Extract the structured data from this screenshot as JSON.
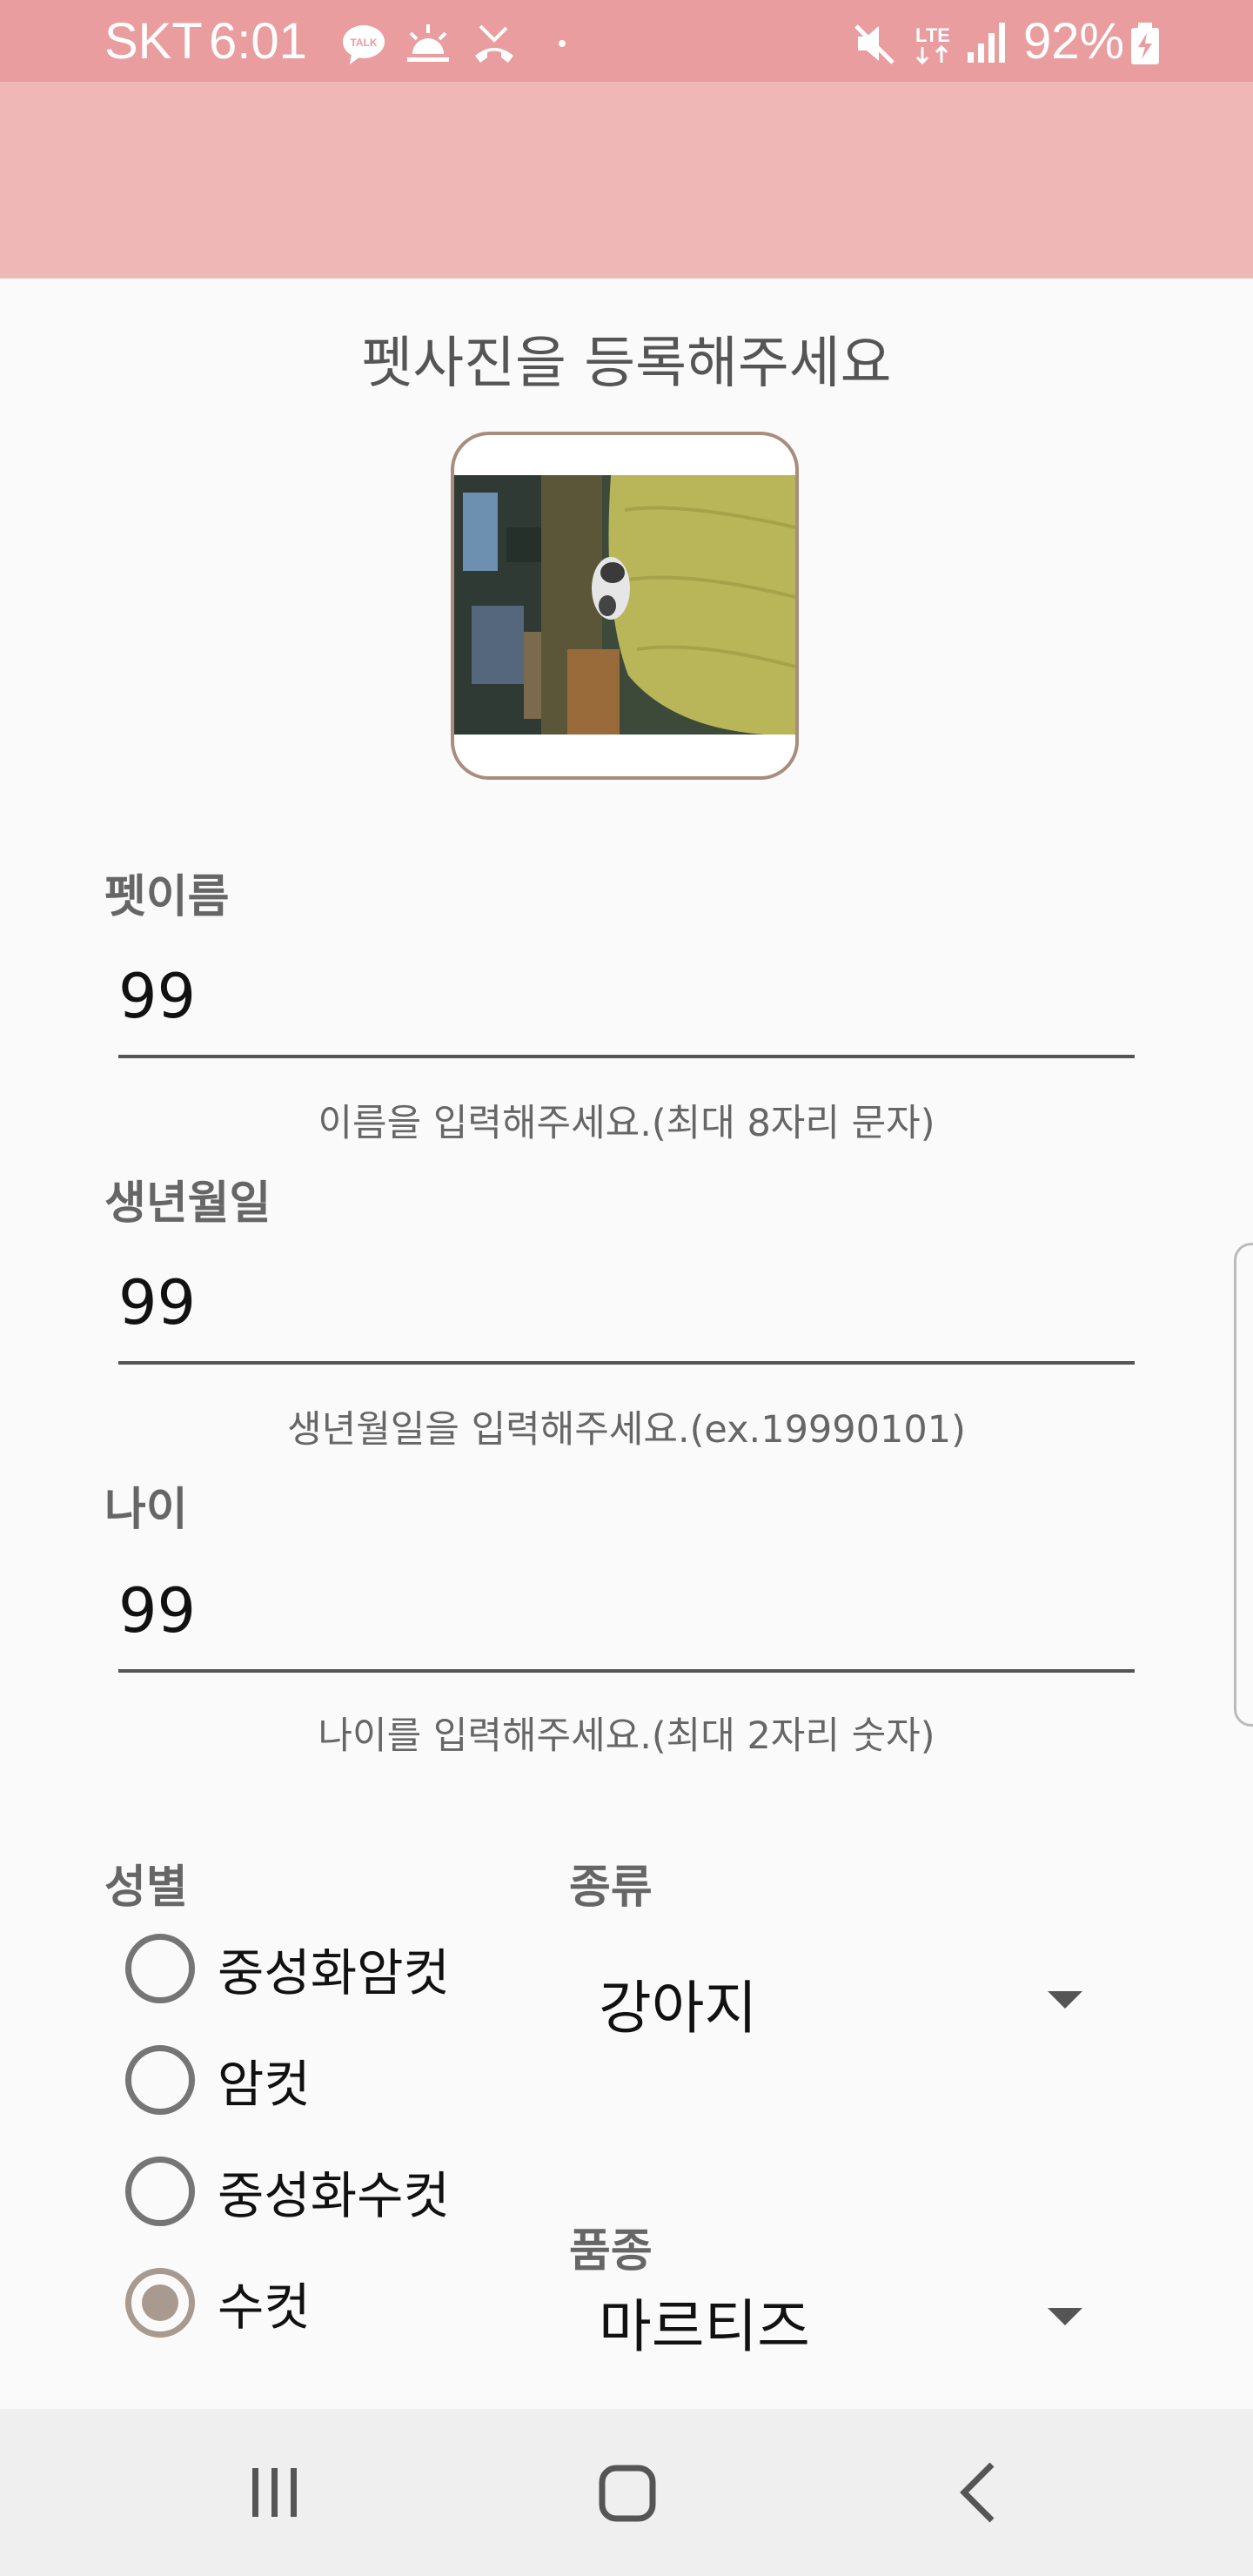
{
  "status_bar": {
    "carrier": "SKT",
    "time": "6:01",
    "battery": "92%",
    "icons": [
      "kakaotalk-icon",
      "weather-icon",
      "missed-call-icon",
      "dot-icon",
      "mute-icon",
      "lte-icon",
      "signal-icon",
      "battery-charging-icon"
    ],
    "lte_label": "LTE"
  },
  "photo": {
    "title": "펫사진을 등록해주세요"
  },
  "fields": {
    "name": {
      "label": "펫이름",
      "value": "99",
      "help": "이름을 입력해주세요.(최대 8자리 문자)"
    },
    "birth": {
      "label": "생년월일",
      "value": "99",
      "help": "생년월일을 입력해주세요.(ex.19990101)"
    },
    "age": {
      "label": "나이",
      "value": "99",
      "help": "나이를 입력해주세요.(최대 2자리 숫자)"
    }
  },
  "gender": {
    "label": "성별",
    "options": [
      "중성화암컷",
      "암컷",
      "중성화수컷",
      "수컷"
    ],
    "selected": "수컷"
  },
  "kind": {
    "label": "종류",
    "value": "강아지"
  },
  "breed": {
    "label": "품종",
    "value": "마르티즈"
  },
  "colors": {
    "status_bar": "#ea9d9f",
    "app_bar": "#f0b7b7",
    "accent": "#a89a8e"
  }
}
